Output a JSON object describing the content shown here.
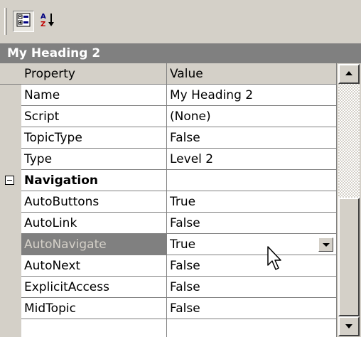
{
  "toolbar": {
    "buttons": [
      {
        "icon": "categorized-icon",
        "pressed": true
      },
      {
        "icon": "sort-alphabetical-icon",
        "pressed": false
      }
    ]
  },
  "panel": {
    "title": "My Heading 2"
  },
  "grid": {
    "header": {
      "property": "Property",
      "value": "Value"
    },
    "rows": [
      {
        "property": "Name",
        "value": "My Heading 2"
      },
      {
        "property": "Script",
        "value": "(None)"
      },
      {
        "property": "TopicType",
        "value": "False"
      },
      {
        "property": "Type",
        "value": "Level 2"
      },
      {
        "property": "Navigation",
        "value": "",
        "category": true,
        "expanded": true
      },
      {
        "property": "AutoButtons",
        "value": "True"
      },
      {
        "property": "AutoLink",
        "value": "False"
      },
      {
        "property": "AutoNavigate",
        "value": "True",
        "selected": true,
        "dropdown": true
      },
      {
        "property": "AutoNext",
        "value": "False"
      },
      {
        "property": "ExplicitAccess",
        "value": "False"
      },
      {
        "property": "MidTopic",
        "value": "False"
      }
    ]
  },
  "colors": {
    "selected_row": "#808080",
    "titlebar": "#808080",
    "chrome": "#d4d0c8"
  }
}
